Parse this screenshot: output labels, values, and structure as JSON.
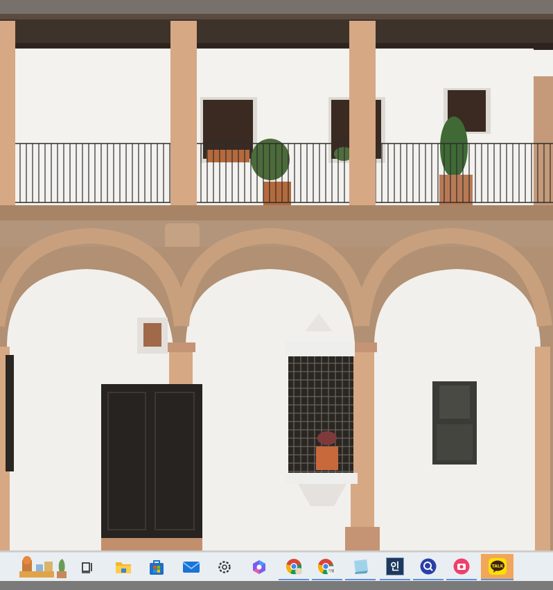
{
  "screen": {
    "wallpaper": "courtyard-arcade-photo",
    "colors": {
      "wall": "#f3f1ee",
      "stone": "#c29a78",
      "brick": "#b08a6c",
      "wood": "#3a2a22",
      "door": "#262320",
      "taskbar": "#e9eef2",
      "active_app": "#f2a65a",
      "running_indicator": "#5b8fd6"
    }
  },
  "taskbar": {
    "widgets_icon": "widgets-plant-icon",
    "items": [
      {
        "name": "task-view",
        "icon": "task-view-icon",
        "running": false
      },
      {
        "name": "file-explorer",
        "icon": "folder-icon",
        "running": false
      },
      {
        "name": "microsoft-store",
        "icon": "store-bag-icon",
        "running": false
      },
      {
        "name": "mail",
        "icon": "mail-icon",
        "running": false
      },
      {
        "name": "settings",
        "icon": "gear-icon",
        "running": false
      },
      {
        "name": "copilot",
        "icon": "copilot-icon",
        "running": false
      },
      {
        "name": "chrome-profile-1",
        "icon": "chrome-icon",
        "running": true
      },
      {
        "name": "chrome-profile-2",
        "icon": "chrome-icon",
        "running": true,
        "badge": "기림"
      },
      {
        "name": "notes",
        "icon": "notepad-icon",
        "running": true
      },
      {
        "name": "hangul-app",
        "icon": "hangul-app-icon",
        "running": true,
        "label": "인"
      },
      {
        "name": "search-app",
        "icon": "blue-search-icon",
        "running": true
      },
      {
        "name": "camera-app",
        "icon": "camera-icon",
        "running": true
      },
      {
        "name": "kakaotalk",
        "icon": "kakaotalk-icon",
        "running": true,
        "active": true,
        "label": "TALK"
      }
    ]
  }
}
